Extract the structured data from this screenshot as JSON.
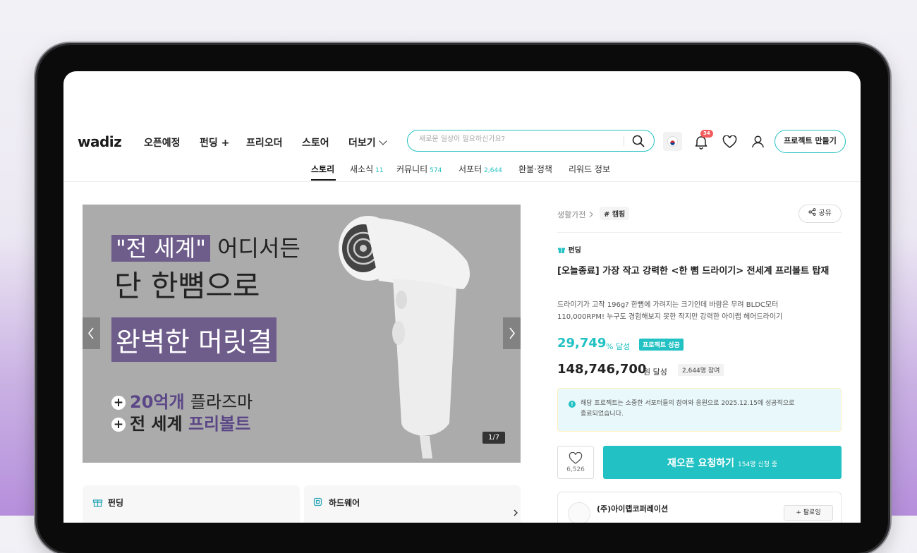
{
  "header": {
    "logo": "wadiz",
    "nav": [
      {
        "label": "오픈예정"
      },
      {
        "label": "펀딩 +"
      },
      {
        "label": "프리오더"
      },
      {
        "label": "스토어"
      },
      {
        "label": "더보기"
      }
    ],
    "search_placeholder": "새로운 일상이 필요하신가요?",
    "notification_count": "34",
    "make_project_label": "프로젝트 만들기"
  },
  "tabs": [
    {
      "label": "스토리",
      "count": ""
    },
    {
      "label": "새소식",
      "count": "11"
    },
    {
      "label": "커뮤니티",
      "count": "574"
    },
    {
      "label": "서포터",
      "count": "2,644"
    },
    {
      "label": "환불·정책",
      "count": ""
    },
    {
      "label": "리워드 정보",
      "count": ""
    }
  ],
  "hero": {
    "line1_highlight": "\"전 세계\"",
    "line1_rest": "어디서든",
    "line2": "단 한뼘으로",
    "line3": "완벽한 머릿결",
    "line4_highlight": "20억개",
    "line4_rest": "플라즈마",
    "line5_rest": "전 세계",
    "line5_highlight": "프리볼트",
    "counter": "1/7"
  },
  "categories": [
    {
      "label": "펀딩"
    },
    {
      "label": "하드웨어"
    }
  ],
  "project": {
    "crumb": "생활가전",
    "tag": "# 캠핑",
    "share_label": "공유",
    "type_label": "펀딩",
    "title": "[오늘종료] 가장 작고 강력한 <한 뼘 드라이기> 전세계 프리볼트 탑재",
    "desc_line1": "드라이기가 고작 196g? 한뼘에 가려지는 크기인데 바람은 무려 BLDC모터",
    "desc_line2": "110,000RPM! 누구도 경험해보지 못한 작지만 강력한 아이랩 헤어드라이기",
    "percent": "29,749",
    "percent_unit": "% 달성",
    "success_badge": "프로젝트 성공",
    "amount": "148,746,700",
    "amount_unit": "원 달성",
    "participants": "2,644명 참여",
    "notice_line1": "해당 프로젝트는 소중한 서포터들의 참여와 응원으로 2025.12.15에 성공적으로",
    "notice_line2": "종료되었습니다.",
    "like_count": "6,526",
    "reopen_label": "재오픈 요청하기",
    "reopen_sub": "154명 신청 중",
    "maker_name": "(주)아이랩코퍼레이션",
    "follow_label": "+ 팔로잉"
  },
  "colors": {
    "accent": "#22c1c3",
    "hero_purple": "#6e5c8b",
    "badge_red": "#f35c5c"
  }
}
